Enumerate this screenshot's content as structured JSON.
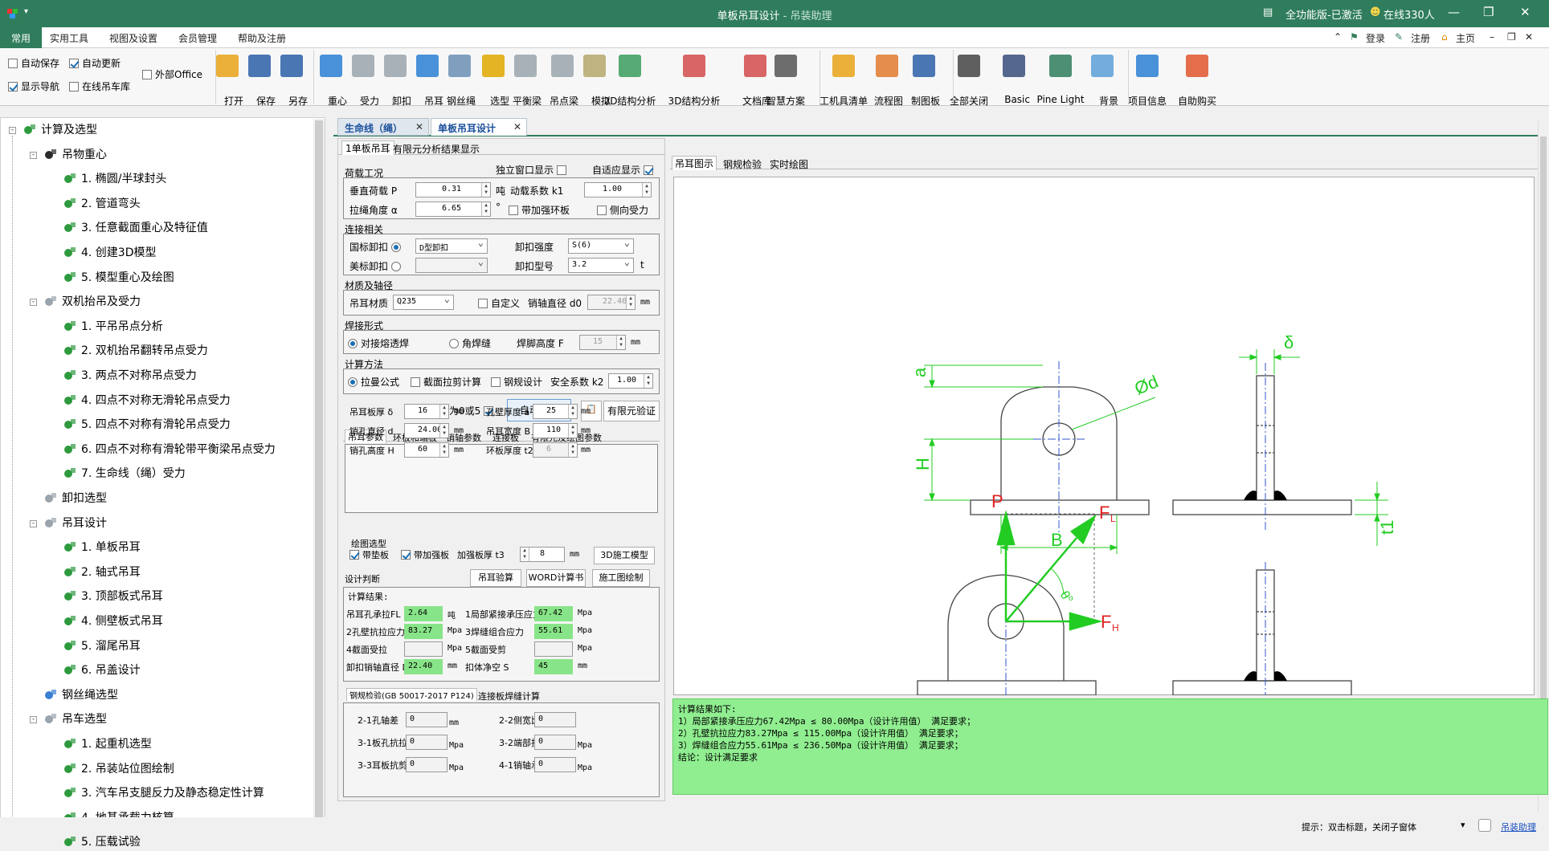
{
  "window": {
    "title": "单板吊耳设计",
    "app_name": "吊装助理",
    "title_sep": " - ",
    "license": "全功能版-已激活",
    "online": "在线330人",
    "account_links": [
      "登录",
      "注册",
      "主页"
    ]
  },
  "menu": {
    "tabs": [
      "常用",
      "实用工具",
      "视图及设置",
      "会员管理",
      "帮助及注册"
    ]
  },
  "ribbon": {
    "checks": [
      {
        "label": "自动保存",
        "checked": false
      },
      {
        "label": "自动更新",
        "checked": true
      },
      {
        "label": "外部Office",
        "checked": false
      },
      {
        "label": "显示导航",
        "checked": true
      },
      {
        "label": "在线吊车库",
        "checked": false
      }
    ],
    "buttons": [
      {
        "label": "打开",
        "icon": "folder-open-icon",
        "color": "#e8a317"
      },
      {
        "label": "保存",
        "icon": "save-icon",
        "color": "#2b5fa8"
      },
      {
        "label": "另存",
        "icon": "save-as-icon",
        "color": "#2b5fa8"
      },
      {
        "label": "重心",
        "icon": "center-of-gravity-icon",
        "color": "#2a7fd4"
      },
      {
        "label": "受力",
        "icon": "force-icon",
        "color": "#9aa4ad"
      },
      {
        "label": "卸扣",
        "icon": "shackle-icon",
        "color": "#9aa4ad"
      },
      {
        "label": "吊耳",
        "icon": "lug-icon",
        "color": "#2a7fd4"
      },
      {
        "label": "钢丝绳",
        "icon": "wire-rope-icon",
        "color": "#6b8fb5"
      },
      {
        "label": "选型",
        "icon": "crane-select-icon",
        "color": "#e0a800"
      },
      {
        "label": "平衡梁",
        "icon": "balance-beam-icon",
        "color": "#9aa4ad"
      },
      {
        "label": "吊点梁",
        "icon": "lifting-beam-icon",
        "color": "#9aa4ad"
      },
      {
        "label": "模拟",
        "icon": "simulate-icon",
        "color": "#b5a76b"
      },
      {
        "label": "2D结构分析",
        "icon": "2d-analysis-icon",
        "color": "#3a9d5d"
      },
      {
        "label": "3D结构分析",
        "icon": "3d-analysis-icon",
        "color": "#d44c4c"
      },
      {
        "label": "文档库",
        "icon": "document-library-icon",
        "color": "#d44c4c"
      },
      {
        "label": "智慧方案",
        "icon": "smart-plan-icon",
        "color": "#555555"
      },
      {
        "label": "工机具清单",
        "icon": "tool-list-icon",
        "color": "#e8a317"
      },
      {
        "label": "流程图",
        "icon": "flowchart-icon",
        "color": "#e07a2e"
      },
      {
        "label": "制图板",
        "icon": "drawing-board-icon",
        "color": "#2b5fa8"
      },
      {
        "label": "全部关闭",
        "icon": "close-all-icon",
        "color": "#444444"
      },
      {
        "label": "Basic",
        "icon": "theme-basic-icon",
        "color": "#3a4d7a"
      },
      {
        "label": "Pine Light",
        "icon": "theme-pine-light-icon",
        "color": "#2f7d5c"
      },
      {
        "label": "背景",
        "icon": "background-icon",
        "color": "#5aa0d8"
      },
      {
        "label": "项目信息",
        "icon": "info-icon",
        "color": "#2a7fd4"
      },
      {
        "label": "自助购买",
        "icon": "cart-icon",
        "color": "#e0562e"
      }
    ]
  },
  "nav": {
    "tree": [
      {
        "label": "计算及选型",
        "level": 0,
        "icon": "green",
        "expander": "-"
      },
      {
        "label": "吊物重心",
        "level": 1,
        "icon": "dark",
        "expander": "-"
      },
      {
        "label": "1. 椭圆/半球封头",
        "level": 2,
        "icon": "green"
      },
      {
        "label": "2. 管道弯头",
        "level": 2,
        "icon": "green"
      },
      {
        "label": "3. 任意截面重心及特征值",
        "level": 2,
        "icon": "green"
      },
      {
        "label": "4. 创建3D模型",
        "level": 2,
        "icon": "green"
      },
      {
        "label": "5. 模型重心及绘图",
        "level": 2,
        "icon": "green"
      },
      {
        "label": "双机抬吊及受力",
        "level": 1,
        "icon": "gray",
        "expander": "-"
      },
      {
        "label": "1. 平吊吊点分析",
        "level": 2,
        "icon": "green"
      },
      {
        "label": "2. 双机抬吊翻转吊点受力",
        "level": 2,
        "icon": "green"
      },
      {
        "label": "3. 两点不对称吊点受力",
        "level": 2,
        "icon": "green"
      },
      {
        "label": "4. 四点不对称无滑轮吊点受力",
        "level": 2,
        "icon": "green"
      },
      {
        "label": "5. 四点不对称有滑轮吊点受力",
        "level": 2,
        "icon": "green"
      },
      {
        "label": "6. 四点不对称有滑轮带平衡梁吊点受力",
        "level": 2,
        "icon": "green"
      },
      {
        "label": "7. 生命线（绳）受力",
        "level": 2,
        "icon": "green"
      },
      {
        "label": "卸扣选型",
        "level": 1,
        "icon": "gray"
      },
      {
        "label": "吊耳设计",
        "level": 1,
        "icon": "gray",
        "expander": "-"
      },
      {
        "label": "1. 单板吊耳",
        "level": 2,
        "icon": "green"
      },
      {
        "label": "2. 轴式吊耳",
        "level": 2,
        "icon": "green"
      },
      {
        "label": "3. 顶部板式吊耳",
        "level": 2,
        "icon": "green"
      },
      {
        "label": "4. 侧壁板式吊耳",
        "level": 2,
        "icon": "green"
      },
      {
        "label": "5. 溜尾吊耳",
        "level": 2,
        "icon": "green"
      },
      {
        "label": "6. 吊盖设计",
        "level": 2,
        "icon": "green"
      },
      {
        "label": "钢丝绳选型",
        "level": 1,
        "icon": "blue"
      },
      {
        "label": "吊车选型",
        "level": 1,
        "icon": "gray",
        "expander": "-"
      },
      {
        "label": "1. 起重机选型",
        "level": 2,
        "icon": "green"
      },
      {
        "label": "2. 吊装站位图绘制",
        "level": 2,
        "icon": "green"
      },
      {
        "label": "3. 汽车吊支腿反力及静态稳定性计算",
        "level": 2,
        "icon": "green"
      },
      {
        "label": "4. 地基承载力核算",
        "level": 2,
        "icon": "green"
      },
      {
        "label": "5. 压载试验",
        "level": 2,
        "icon": "green"
      }
    ]
  },
  "doc_tabs": [
    {
      "label": "生命线（绳）",
      "active": false
    },
    {
      "label": "单板吊耳设计",
      "active": true
    }
  ],
  "form": {
    "tabs": [
      "1单板吊耳",
      "有限元分析结果显示"
    ],
    "load": {
      "section": "荷载工况",
      "independent_window": "独立窗口显示",
      "adaptive_display": "自适应显示",
      "vertical_load_label": "垂直荷载 P",
      "vertical_load": "0.31",
      "vertical_unit": "吨",
      "dynamic_factor_label": "动载系数 k1",
      "dynamic_factor": "1.00",
      "rope_angle_label": "拉绳角度 α",
      "rope_angle": "6.65",
      "angle_unit": "°",
      "add_ring_plate": "带加强环板",
      "lateral_force": "侧向受力"
    },
    "connection": {
      "section": "连接相关",
      "gb_shackle": "国标卸扣",
      "gb_type": "D型卸扣",
      "shackle_strength_label": "卸扣强度",
      "shackle_strength": "S(6)",
      "us_shackle": "美标卸扣",
      "shackle_model_label": "卸扣型号",
      "shackle_model": "3.2",
      "shackle_model_unit": "t"
    },
    "material": {
      "section": "材质及轴径",
      "lug_material_label": "吊耳材质",
      "lug_material": "Q235",
      "custom": "自定义",
      "pin_diameter_label": "销轴直径 d0",
      "pin_diameter": "22.40",
      "pin_unit": "mm"
    },
    "weld": {
      "section": "焊接形式",
      "butt": "对接熔透焊",
      "fillet": "角焊缝",
      "leg_label": "焊脚高度 F",
      "leg_value": "15",
      "leg_unit": "mm"
    },
    "method": {
      "section": "计算方法",
      "lame": "拉曼公式",
      "shear": "截面拉剪计算",
      "steel": "钢规设计",
      "safety_label": "安全系数 k2",
      "safety": "1.00"
    },
    "tail": "尾数为0或5",
    "auto_design_btn": "自动设计",
    "fea_btn": "有限元验证",
    "param_tabs": [
      "吊耳参数",
      "环板和端板",
      "销轴参数",
      "连接板",
      "有限元及绘图参数"
    ],
    "params": [
      {
        "label": "吊耳板厚 δ",
        "value": "16",
        "unit": "mm"
      },
      {
        "label": "孔壁厚度 a",
        "value": "25",
        "unit": "mm"
      },
      {
        "label": "销孔直径 d",
        "value": "24.00",
        "unit": "mm"
      },
      {
        "label": "吊耳宽度 B",
        "value": "110",
        "unit": "mm"
      },
      {
        "label": "销孔高度 H",
        "value": "60",
        "unit": "mm"
      },
      {
        "label": "环板厚度 t2",
        "value": "6",
        "unit": "mm"
      }
    ],
    "drawing": {
      "section": "绘图选型",
      "pad": "带垫板",
      "stiffener": "带加强板",
      "stiff_thk_label": "加强板厚 t3",
      "stiff_thk": "8",
      "stiff_unit": "mm",
      "model3d_btn": "3D施工模型"
    },
    "design_check": {
      "section": "设计判断",
      "lug_check_btn": "吊耳验算",
      "word_btn": "WORD计算书",
      "cad_btn": "施工图绘制"
    },
    "calc": {
      "title": "计算结果:",
      "rows": [
        {
          "l1": "吊耳孔承拉FL",
          "v1": "2.64",
          "u1": "吨",
          "l2": "1局部紧接承压应力",
          "v2": "67.42",
          "u2": "Mpa"
        },
        {
          "l1": "2孔壁抗拉应力",
          "v1": "83.27",
          "u1": "Mpa",
          "l2": "3焊缝组合应力",
          "v2": "55.61",
          "u2": "Mpa"
        },
        {
          "l1": "4截面受拉",
          "v1": "",
          "u1": "Mpa",
          "l2": "5截面受剪",
          "v2": "",
          "u2": "Mpa"
        },
        {
          "l1": "卸扣销轴直径 D",
          "v1": "22.40",
          "u1": "mm",
          "l2": "扣体净空 S",
          "v2": "45",
          "u2": "mm"
        }
      ]
    },
    "steel_tabs": [
      "钢规检验(GB 50017-2017 P124)",
      "连接板焊缝计算"
    ],
    "steel": [
      {
        "label": "2-1孔轴差",
        "value": "0",
        "unit": "mm"
      },
      {
        "label": "2-2侧宽比厚",
        "value": "0",
        "unit": ""
      },
      {
        "label": "3-1板孔抗拉",
        "value": "0",
        "unit": "Mpa"
      },
      {
        "label": "3-2端部抗拉",
        "value": "0",
        "unit": "Mpa"
      },
      {
        "label": "3-3耳板抗剪",
        "value": "0",
        "unit": "Mpa"
      },
      {
        "label": "4-1销轴承压",
        "value": "0",
        "unit": "Mpa"
      }
    ]
  },
  "view": {
    "tabs": [
      "吊耳图示",
      "钢规检验",
      "实时绘图"
    ],
    "labels": {
      "a": "a",
      "H": "H",
      "B": "B",
      "d": "Ød",
      "delta": "δ",
      "t1": "t1",
      "P": "P",
      "FL": "F",
      "FL_sub": "L",
      "FH": "F",
      "FH_sub": "H",
      "theta": "θ",
      "theta_sub": "o"
    }
  },
  "results": {
    "lines": [
      "计算结果如下:",
      "    1）局部紧接承压应力67.42Mpa ≤ 80.00Mpa（设计许用值） 满足要求；",
      "    2）孔壁抗拉应力83.27Mpa ≤ 115.00Mpa（设计许用值） 满足要求；",
      "    3）焊缝组合应力55.61Mpa ≤ 236.50Mpa（设计许用值） 满足要求；",
      "    结论：设计满足要求"
    ]
  },
  "status": {
    "hint": "提示：双击标题，关闭子窗体",
    "link": "吊装助理"
  },
  "colors": {
    "accent": "#2f7d5c",
    "result_bg": "#90ee90",
    "dim_green": "#22cc22",
    "axis_blue": "#3355cc",
    "field_green": "#88e488"
  }
}
